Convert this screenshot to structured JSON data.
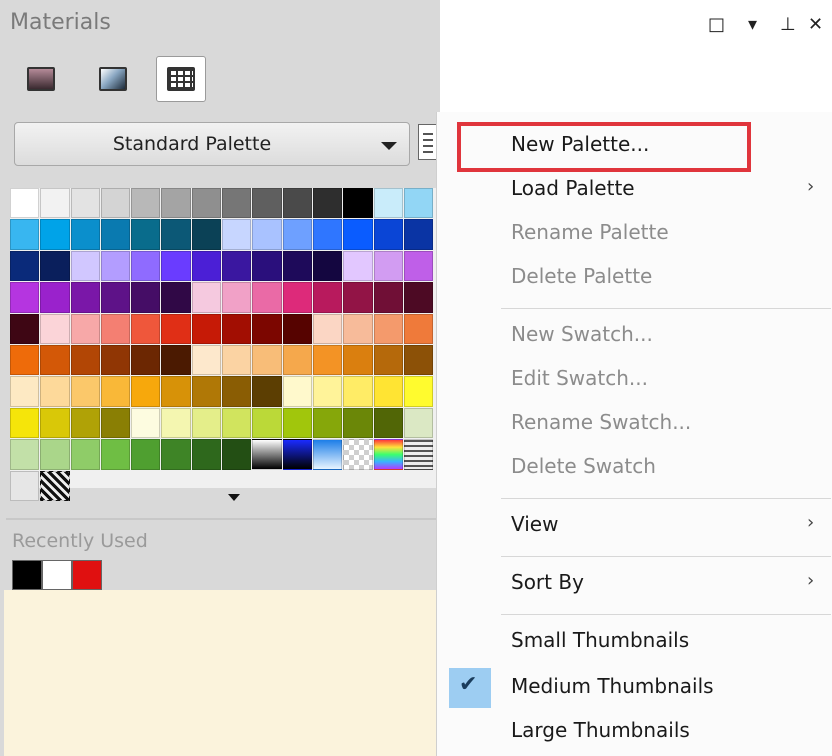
{
  "panel": {
    "title": "Materials",
    "palette_select_label": "Standard Palette",
    "recently_used_label": "Recently Used",
    "recent_colors": [
      "#000000",
      "#ffffff",
      "#e01010"
    ]
  },
  "window_controls": {
    "maximize": "□",
    "dropdown": "▾",
    "pin": "⊥",
    "close": "✕"
  },
  "swatches": [
    "#ffffff",
    "#f2f2f2",
    "#e3e3e3",
    "#d4d4d4",
    "#b8b8b8",
    "#a4a4a4",
    "#8f8f8f",
    "#767676",
    "#5f5f5f",
    "#4a4a4a",
    "#2e2e2e",
    "#000000",
    "#c9ecfa",
    "#92d6f5",
    "#38b6f0",
    "#00a3e8",
    "#0b8fcc",
    "#0a7ab0",
    "#096c8c",
    "#0c5876",
    "#0b4156",
    "#c7d6ff",
    "#a9c2ff",
    "#6ea0ff",
    "#2f76ff",
    "#0a5cff",
    "#0a45d6",
    "#0a34a4",
    "#0a2a7a",
    "#0a1f5c",
    "#d1c7ff",
    "#b39dff",
    "#8f6bff",
    "#6a3cff",
    "#4b1fd6",
    "#3a17a0",
    "#2a0f7c",
    "#1e0a5a",
    "#140640",
    "#e2c7ff",
    "#d29cf2",
    "#bf5fe8",
    "#b535e0",
    "#9a22cc",
    "#7a17a8",
    "#5e1288",
    "#450d66",
    "#300846",
    "#f5c9df",
    "#f1a1c7",
    "#ea6aa6",
    "#dd2a7a",
    "#b81a5d",
    "#921446",
    "#700f36",
    "#4d0a24",
    "#3e0614",
    "#fbd4d8",
    "#f7a8a8",
    "#f47f72",
    "#ef573b",
    "#e02f16",
    "#c61a06",
    "#a20e02",
    "#7c0600",
    "#560300",
    "#fbd6c4",
    "#f7bb9a",
    "#f49a6c",
    "#ef7a3a",
    "#ee6b0a",
    "#d35807",
    "#b24605",
    "#903604",
    "#6c2702",
    "#4b1a01",
    "#fde8cc",
    "#fbd3a3",
    "#f8bd78",
    "#f5a84c",
    "#f39325",
    "#da7f0f",
    "#b5690b",
    "#8c5107",
    "#fde9c3",
    "#fdd99a",
    "#fbc86a",
    "#f9b838",
    "#f7a80c",
    "#d79208",
    "#b07806",
    "#8a5d04",
    "#5c3e02",
    "#fff9cc",
    "#fff399",
    "#ffec66",
    "#ffe433",
    "#fffb2e",
    "#f5e50a",
    "#d9c808",
    "#b0a206",
    "#8a7f04",
    "#fdfce0",
    "#f4f6b0",
    "#e4ee8a",
    "#d1e45e",
    "#bbd938",
    "#a1c60c",
    "#86a70a",
    "#6b8708",
    "#516606",
    "#dbe8c4",
    "#c2e0a8",
    "#aad68a",
    "#8fcc68",
    "#6fbe44",
    "#4f9f30",
    "#3e8426",
    "#2e681c",
    "#234f14",
    "#gradient-bw",
    "#gradient-blue",
    "#gradient-sky",
    "#gradient-check",
    "#gradient-rainbow",
    "#gradient-lines",
    "#e6e6e6",
    "#pattern-zebra"
  ],
  "menu": {
    "items": [
      {
        "label": "New Palette...",
        "disabled": false
      },
      {
        "label": "Load Palette",
        "disabled": false
      },
      {
        "label": "Rename Palette",
        "disabled": true
      },
      {
        "label": "Delete Palette",
        "disabled": true
      },
      {
        "label": "New Swatch...",
        "disabled": true
      },
      {
        "label": "Edit Swatch...",
        "disabled": true
      },
      {
        "label": "Rename Swatch...",
        "disabled": true
      },
      {
        "label": "Delete Swatch",
        "disabled": true
      },
      {
        "label": "View",
        "disabled": false
      },
      {
        "label": "Sort By",
        "disabled": false
      },
      {
        "label": "Small Thumbnails",
        "disabled": false
      },
      {
        "label": "Medium Thumbnails",
        "disabled": false,
        "checked": true
      },
      {
        "label": "Large Thumbnails",
        "disabled": false
      }
    ],
    "submenu_arrow": "›",
    "check_mark": "✔",
    "highlight_color": "#e0353c"
  }
}
